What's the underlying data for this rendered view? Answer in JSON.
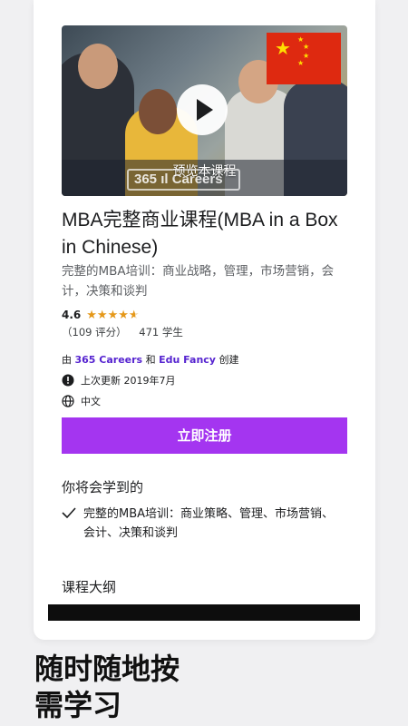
{
  "course": {
    "preview_label": "预览本课程",
    "title": "MBA完整商业课程(MBA in a Box in Chinese)",
    "subtitle": "完整的MBA培训：商业战略，管理，市场营销，会计，决策和谈判",
    "rating": "4.6",
    "rating_value": 4.6,
    "reviews": "（109 评分）",
    "students": "471 学生",
    "created_by_prefix": "由",
    "creator_1": "365 Careers",
    "creator_and": "和",
    "creator_2": "Edu Fancy",
    "created_by_suffix": "创建",
    "last_updated": "上次更新 2019年7月",
    "language": "中文",
    "enroll_label": "立即注册",
    "logo_text": "365 ıl Careers"
  },
  "learn": {
    "heading": "你将会学到的",
    "items": [
      "完整的MBA培训：商业策略、管理、市场营销、会计、决策和谈判"
    ]
  },
  "syllabus": {
    "heading": "课程大纲"
  },
  "tagline": {
    "line1": "随时随地按",
    "line2": "需学习"
  },
  "colors": {
    "accent": "#a435f0",
    "link": "#5624d0",
    "star": "#e59819"
  },
  "icons": [
    "play-icon",
    "star-icon",
    "alert-icon",
    "globe-icon",
    "check-icon",
    "china-flag-icon"
  ]
}
